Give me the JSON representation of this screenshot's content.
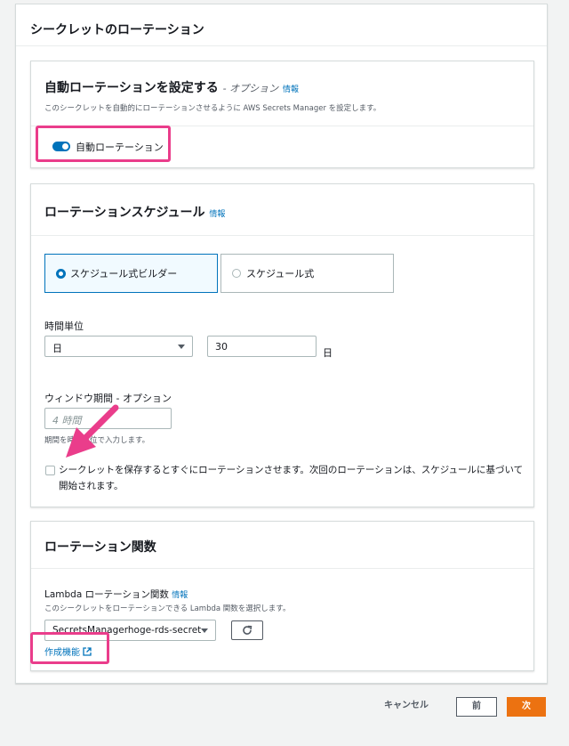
{
  "section": {
    "title": "シークレットのローテーション"
  },
  "auto_rotation": {
    "title": "自動ローテーションを設定する",
    "optional": "- オプション",
    "info": "情報",
    "description": "このシークレットを自動的にローテーションさせるように AWS Secrets Manager を設定します。",
    "toggle_label": "自動ローテーション",
    "toggle_on": true
  },
  "schedule": {
    "title": "ローテーションスケジュール",
    "info": "情報",
    "options": [
      {
        "label": "スケジュール式ビルダー",
        "selected": true
      },
      {
        "label": "スケジュール式",
        "selected": false
      }
    ],
    "time_unit_label": "時間単位",
    "time_unit_value": "日",
    "interval_value": "30",
    "interval_unit": "日",
    "window_label": "ウィンドウ期間 - オプション",
    "window_placeholder": "4 時間",
    "window_hint": "期間を時間単位で入力します。",
    "immediate_rotation_text": "シークレットを保存するとすぐにローテーションさせます。次回のローテーションは、スケジュールに基づいて開始されます。",
    "immediate_rotation_checked": false
  },
  "rotation_function": {
    "title": "ローテーション関数",
    "lambda_label": "Lambda ローテーション関数",
    "info": "情報",
    "lambda_description": "このシークレットをローテーションできる Lambda 関数を選択します。",
    "lambda_value": "SecretsManagerhoge-rds-secret",
    "create_link": "作成機能"
  },
  "footer": {
    "cancel": "キャンセル",
    "previous": "前",
    "next": "次"
  },
  "colors": {
    "accent": "#0073bb",
    "primary_button": "#ec7211",
    "highlight": "#ea3d8b"
  }
}
